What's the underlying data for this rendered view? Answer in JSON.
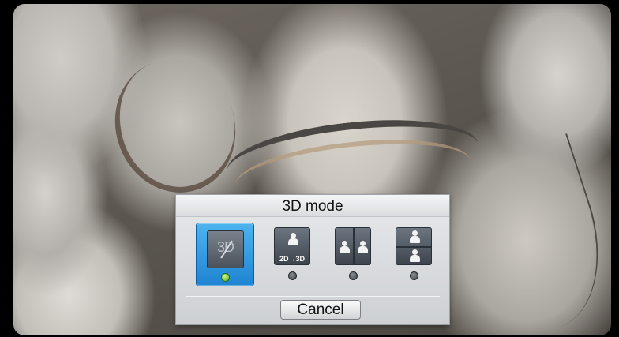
{
  "dialog": {
    "title": "3D mode",
    "cancel_label": "Cancel"
  },
  "modes": [
    {
      "icon": "3d-off-icon",
      "label": "3D",
      "selected": true
    },
    {
      "icon": "2d-to-3d-icon",
      "caption": "2D→3D",
      "selected": false
    },
    {
      "icon": "side-by-side-icon",
      "selected": false
    },
    {
      "icon": "top-and-bottom-icon",
      "selected": false
    }
  ],
  "colors": {
    "selected_highlight": "#2b9be3",
    "indicator_on": "#6cc92a",
    "indicator_off": "#4a4f54"
  }
}
